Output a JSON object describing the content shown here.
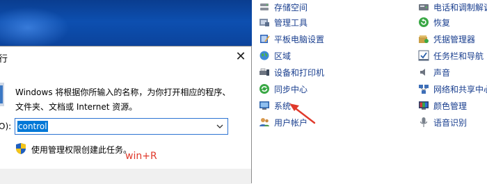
{
  "run_dialog": {
    "title": "行",
    "close_glyph": "✕",
    "desc_line1": "Windows 将根据你所输入的名称，为你打开相应的程序、",
    "desc_line2": "文件夹、文档或 Internet 资源。",
    "open_label": "O):",
    "input_value": "control",
    "admin_text": "使用管理权限创建此任务。",
    "hint": "win+R"
  },
  "control_panel": {
    "left_column": [
      {
        "label": "存储空间",
        "icon": "storage-icon"
      },
      {
        "label": "管理工具",
        "icon": "admin-tools-icon"
      },
      {
        "label": "平板电脑设置",
        "icon": "tablet-settings-icon"
      },
      {
        "label": "区域",
        "icon": "region-icon"
      },
      {
        "label": "设备和打印机",
        "icon": "devices-printers-icon"
      },
      {
        "label": "同步中心",
        "icon": "sync-center-icon"
      },
      {
        "label": "系统",
        "icon": "system-icon"
      },
      {
        "label": "用户帐户",
        "icon": "user-accounts-icon"
      }
    ],
    "right_column": [
      {
        "label": "电话和调制解调",
        "icon": "phone-modem-icon"
      },
      {
        "label": "恢复",
        "icon": "recovery-icon"
      },
      {
        "label": "凭据管理器",
        "icon": "credential-manager-icon"
      },
      {
        "label": "任务栏和导航",
        "icon": "taskbar-navigation-icon"
      },
      {
        "label": "声音",
        "icon": "sound-icon"
      },
      {
        "label": "网络和共享中心",
        "icon": "network-sharing-icon"
      },
      {
        "label": "颜色管理",
        "icon": "color-management-icon"
      },
      {
        "label": "语音识别",
        "icon": "speech-recognition-icon"
      }
    ]
  },
  "colors": {
    "link_blue": "#1a3f8f",
    "annotation_red": "#e0392b",
    "selection_blue": "#0078d7"
  }
}
